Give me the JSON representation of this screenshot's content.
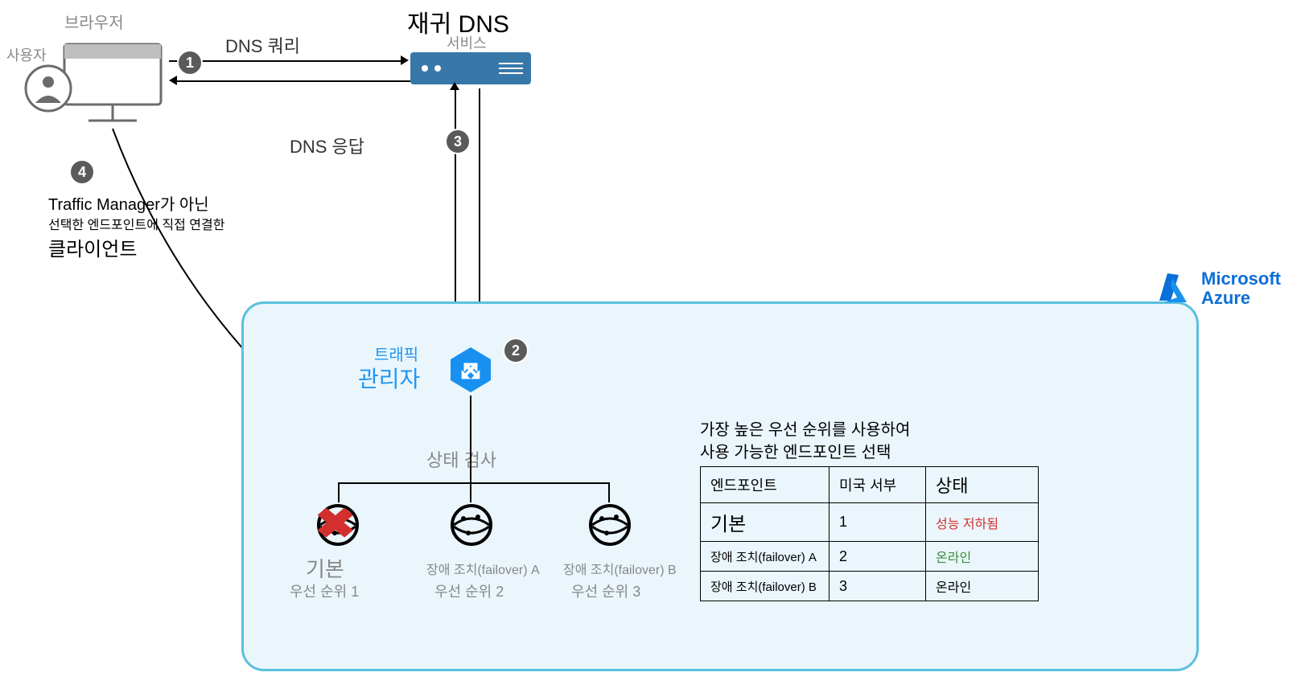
{
  "labels": {
    "browser": "브라우저",
    "user": "사용자",
    "dns_query": "DNS 쿼리",
    "recursive_dns": "재귀 DNS",
    "service": "서비스",
    "dns_response": "DNS 응답",
    "step4_line1": "Traffic  Manager가 아닌",
    "step4_line2": "선택한 엔드포인트에 직접 연결한",
    "step4_line3": "클라이언트",
    "traffic": "트래픽",
    "manager": "관리자",
    "health_check": "상태 검사",
    "primary": "기본",
    "priority1": "우선 순위 1",
    "failoverA": "장애 조치(failover) A",
    "priority2": "우선 순위 2",
    "failoverB": "장애 조치(failover) B",
    "priority3": "우선 순위 3",
    "table_title1": "가장 높은 우선 순위를 사용하여",
    "table_title2": "사용 가능한 엔드포인트 선택",
    "azure_line1": "Microsoft",
    "azure_line2": "Azure"
  },
  "steps": {
    "s1": "1",
    "s2": "2",
    "s3": "3",
    "s4": "4"
  },
  "table": {
    "headers": {
      "c1": "엔드포인트",
      "c2": "미국 서부",
      "c3": "상태"
    },
    "rows": [
      {
        "endpoint": "기본",
        "region": "1",
        "status": "성능 저하됨",
        "status_class": "status-red"
      },
      {
        "endpoint": "장애 조치(failover) A",
        "region": "2",
        "status": "온라인",
        "status_class": "status-green"
      },
      {
        "endpoint": "장애 조치(failover) B",
        "region": "3",
        "status": "온라인",
        "status_class": ""
      }
    ]
  }
}
